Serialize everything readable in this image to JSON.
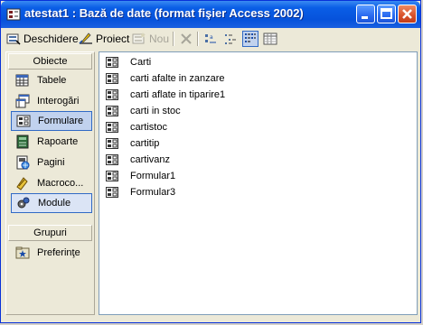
{
  "window": {
    "title": "atestat1 : Bază de date (format fişier Access 2002)"
  },
  "toolbar": {
    "open_label": "Deschidere",
    "design_label": "Proiect",
    "new_label": "Nou"
  },
  "sidebar": {
    "objects_header": "Obiecte",
    "objects": [
      {
        "label": "Tabele",
        "icon": "table-icon"
      },
      {
        "label": "Interogări",
        "icon": "query-icon"
      },
      {
        "label": "Formulare",
        "icon": "form-icon"
      },
      {
        "label": "Rapoarte",
        "icon": "report-icon"
      },
      {
        "label": "Pagini",
        "icon": "page-icon"
      },
      {
        "label": "Macroco...",
        "icon": "macro-icon"
      },
      {
        "label": "Module",
        "icon": "module-icon"
      }
    ],
    "groups_header": "Grupuri",
    "groups": [
      {
        "label": "Preferinţe",
        "icon": "favorites-icon"
      }
    ]
  },
  "forms": [
    "Carti",
    "carti afalte in zanzare",
    "carti aflate in tiparire1",
    "carti in stoc",
    "cartistoc",
    "cartitip",
    "cartivanz",
    "Formular1",
    "Formular3"
  ]
}
